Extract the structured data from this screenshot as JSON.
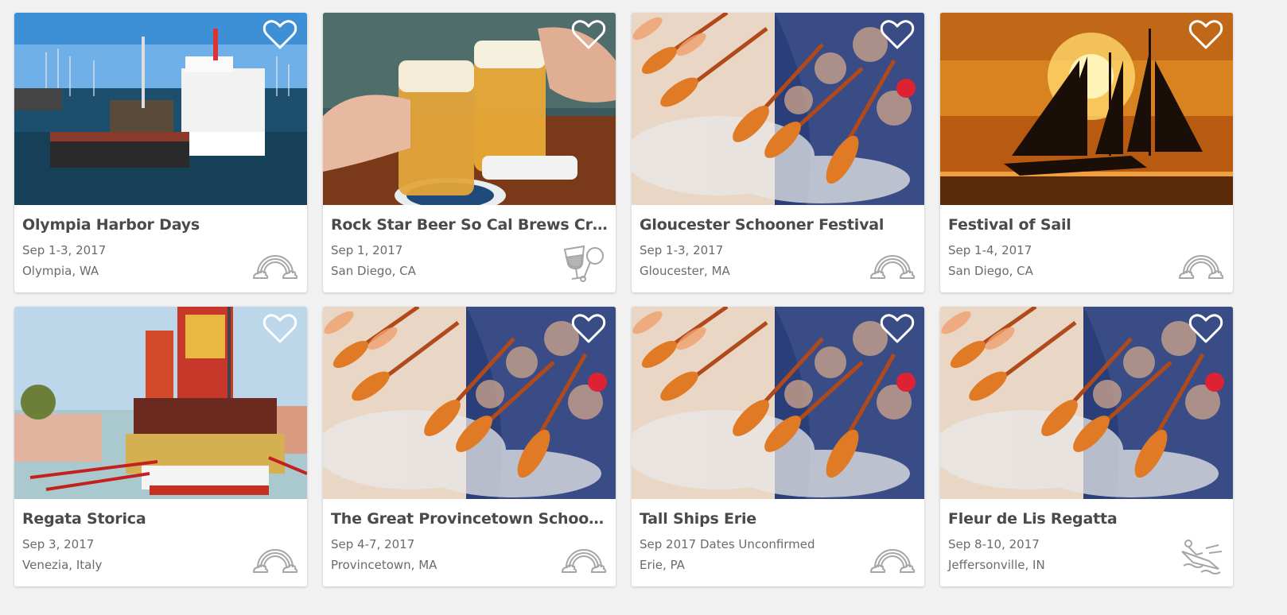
{
  "events": [
    {
      "title": "Olympia Harbor Days",
      "date": "Sep 1-3, 2017",
      "location": "Olympia, WA",
      "image": "harbor-boats",
      "type_icon": "rainbow-icon"
    },
    {
      "title": "Rock Star Beer So Cal Brews Cruise",
      "date": "Sep 1, 2017",
      "location": "San Diego, CA",
      "image": "beer-mugs",
      "type_icon": "food-drink-icon"
    },
    {
      "title": "Gloucester Schooner Festival",
      "date": "Sep 1-3, 2017",
      "location": "Gloucester, MA",
      "image": "rowing-oars",
      "type_icon": "rainbow-icon"
    },
    {
      "title": "Festival of Sail",
      "date": "Sep 1-4, 2017",
      "location": "San Diego, CA",
      "image": "sunset-schooner",
      "type_icon": "rainbow-icon"
    },
    {
      "title": "Regata Storica",
      "date": "Sep 3, 2017",
      "location": "Venezia, Italy",
      "image": "venetian-boat",
      "type_icon": "rainbow-icon"
    },
    {
      "title": "The Great Provincetown Schooner…",
      "date": "Sep 4-7, 2017",
      "location": "Provincetown, MA",
      "image": "rowing-oars",
      "type_icon": "rainbow-icon"
    },
    {
      "title": "Tall Ships Erie",
      "date": "Sep 2017 Dates Unconfirmed",
      "location": "Erie, PA",
      "image": "rowing-oars",
      "type_icon": "rainbow-icon"
    },
    {
      "title": "Fleur de Lis Regatta",
      "date": "Sep 8-10, 2017",
      "location": "Jeffersonville, IN",
      "image": "rowing-oars",
      "type_icon": "racing-boat-icon"
    }
  ],
  "colors": {
    "title": "#4a4a4a",
    "meta": "#6b6b6b",
    "icon": "#9a9a9a",
    "background": "#f1f1f1"
  }
}
